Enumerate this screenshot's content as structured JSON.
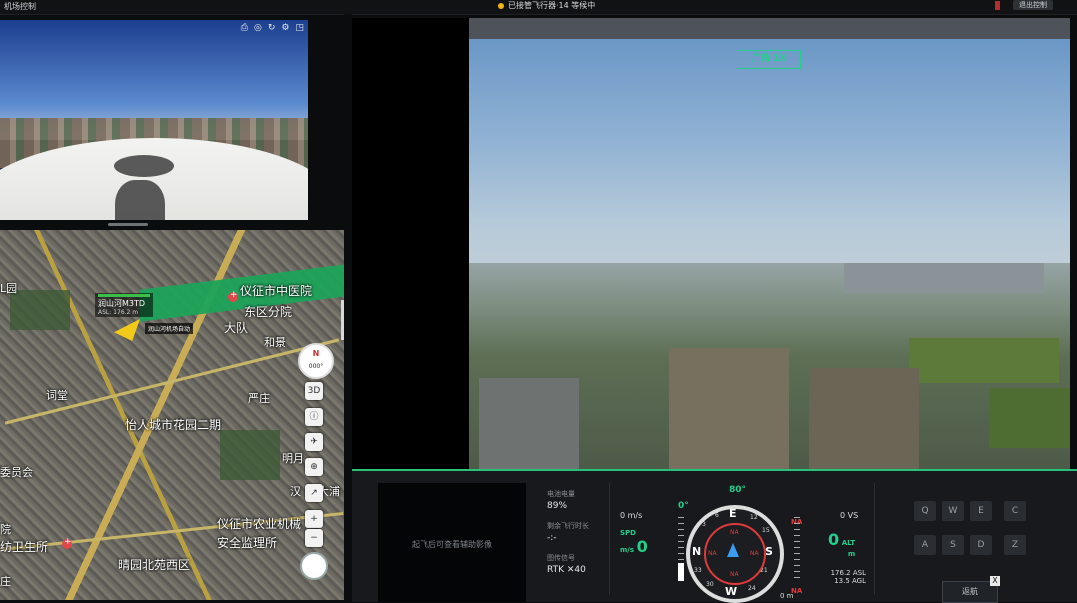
{
  "topbar": {
    "app_name": "机场控制",
    "status": "已接管飞行器·14 等候中",
    "exit_label": "退出控制"
  },
  "left_video": {
    "toolbar_icons": [
      "camera-icon",
      "fisheye-icon",
      "refresh-icon",
      "settings-icon",
      "expand-icon"
    ]
  },
  "map": {
    "labels": [
      {
        "text": "仪征市中医院",
        "cls": ""
      },
      {
        "text": "东区分院",
        "cls": ""
      },
      {
        "text": "大队",
        "cls": ""
      },
      {
        "text": "和景",
        "cls": "sm"
      },
      {
        "text": "严庄",
        "cls": "sm"
      },
      {
        "text": "词堂",
        "cls": "sm"
      },
      {
        "text": "怡人城市花园二期",
        "cls": ""
      },
      {
        "text": "明月",
        "cls": "sm"
      },
      {
        "text": "汉",
        "cls": "sm"
      },
      {
        "text": "大浦",
        "cls": "sm"
      },
      {
        "text": "仪征市农业机械",
        "cls": ""
      },
      {
        "text": "安全监理所",
        "cls": ""
      },
      {
        "text": "委员会",
        "cls": "sm"
      },
      {
        "text": "纺卫生所",
        "cls": ""
      },
      {
        "text": "晴园北苑西区",
        "cls": ""
      },
      {
        "text": "L园",
        "cls": "sm"
      },
      {
        "text": "院",
        "cls": "sm"
      },
      {
        "text": "庄",
        "cls": "sm"
      }
    ],
    "drone_name": "润山河M3TD",
    "drone_asl": "ASL: 176.2 m",
    "dock_tag": "润山河机场自动",
    "compass_dir": "N",
    "compass_deg": "000°",
    "controls": [
      "3D",
      "ⓘ",
      "✈",
      "⊕",
      "↗",
      "+",
      "−"
    ]
  },
  "main_video": {
    "lens_label": "广角 1X"
  },
  "panel": {
    "pip_text": "起飞后可查看辅助影像",
    "battery_label": "电池电量",
    "battery_value": "89%",
    "flight_time_label": "剩余飞行时长",
    "flight_time_value": "-:-",
    "signal_label": "图传信号",
    "signal_value": "RTK ✕40",
    "hs_value": "0 m/s",
    "spd_value": "0",
    "spd_unit_top": "SPD",
    "spd_unit_bottom": "m/s",
    "left_deg": "0°",
    "heading": "80°",
    "na": "NA",
    "vs": "0 VS",
    "alt_big": "0",
    "alt_label": "ALT",
    "alt_unit": "m",
    "asl": "176.2 ASL",
    "agl": "13.5 AGL",
    "bottom_m": "0 m",
    "compass_letters": {
      "n": "N",
      "e": "E",
      "s": "S",
      "w": "W"
    },
    "compass_ticks": {
      "t3": "3",
      "t6": "6",
      "t12": "12",
      "t15": "15",
      "t21": "21",
      "t24": "24",
      "t30": "30",
      "t33": "33"
    },
    "keys": [
      "Q",
      "W",
      "E",
      "C",
      "A",
      "S",
      "D",
      "Z"
    ],
    "return_label": "返航",
    "close_label": "X"
  }
}
